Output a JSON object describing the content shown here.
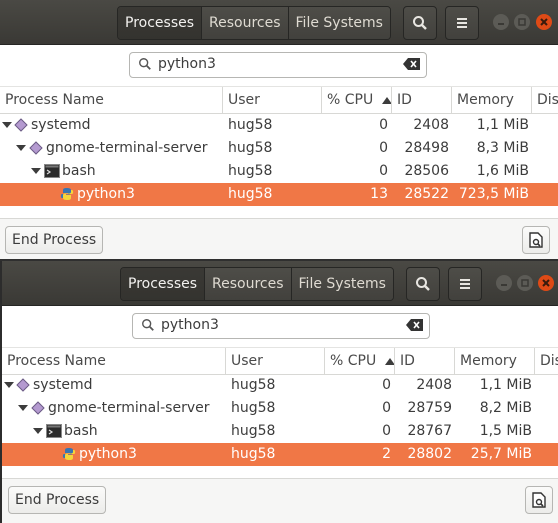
{
  "tabs": [
    "Processes",
    "Resources",
    "File Systems"
  ],
  "search": {
    "value": "python3"
  },
  "columns": [
    "Process Name",
    "User",
    "% CPU",
    "ID",
    "Memory",
    "Dis"
  ],
  "end_process_label": "End Process",
  "colors": {
    "selected_row": "#f07746",
    "headerbar": "#3c3b37",
    "close_button": "#df4a16"
  },
  "icons": {
    "tree_parent": "diamond-process-icon",
    "terminal": "terminal-icon",
    "python": "python-icon"
  },
  "windows": [
    {
      "rows": [
        {
          "name": "systemd",
          "user": "hug58",
          "cpu": "0",
          "id": "2408",
          "memory": "1,1 MiB"
        },
        {
          "name": "gnome-terminal-server",
          "user": "hug58",
          "cpu": "0",
          "id": "28498",
          "memory": "8,3 MiB"
        },
        {
          "name": "bash",
          "user": "hug58",
          "cpu": "0",
          "id": "28506",
          "memory": "1,6 MiB"
        },
        {
          "name": "python3",
          "user": "hug58",
          "cpu": "13",
          "id": "28522",
          "memory": "723,5 MiB"
        }
      ]
    },
    {
      "rows": [
        {
          "name": "systemd",
          "user": "hug58",
          "cpu": "0",
          "id": "2408",
          "memory": "1,1 MiB"
        },
        {
          "name": "gnome-terminal-server",
          "user": "hug58",
          "cpu": "0",
          "id": "28759",
          "memory": "8,2 MiB"
        },
        {
          "name": "bash",
          "user": "hug58",
          "cpu": "0",
          "id": "28767",
          "memory": "1,5 MiB"
        },
        {
          "name": "python3",
          "user": "hug58",
          "cpu": "2",
          "id": "28802",
          "memory": "25,7 MiB"
        }
      ]
    }
  ]
}
